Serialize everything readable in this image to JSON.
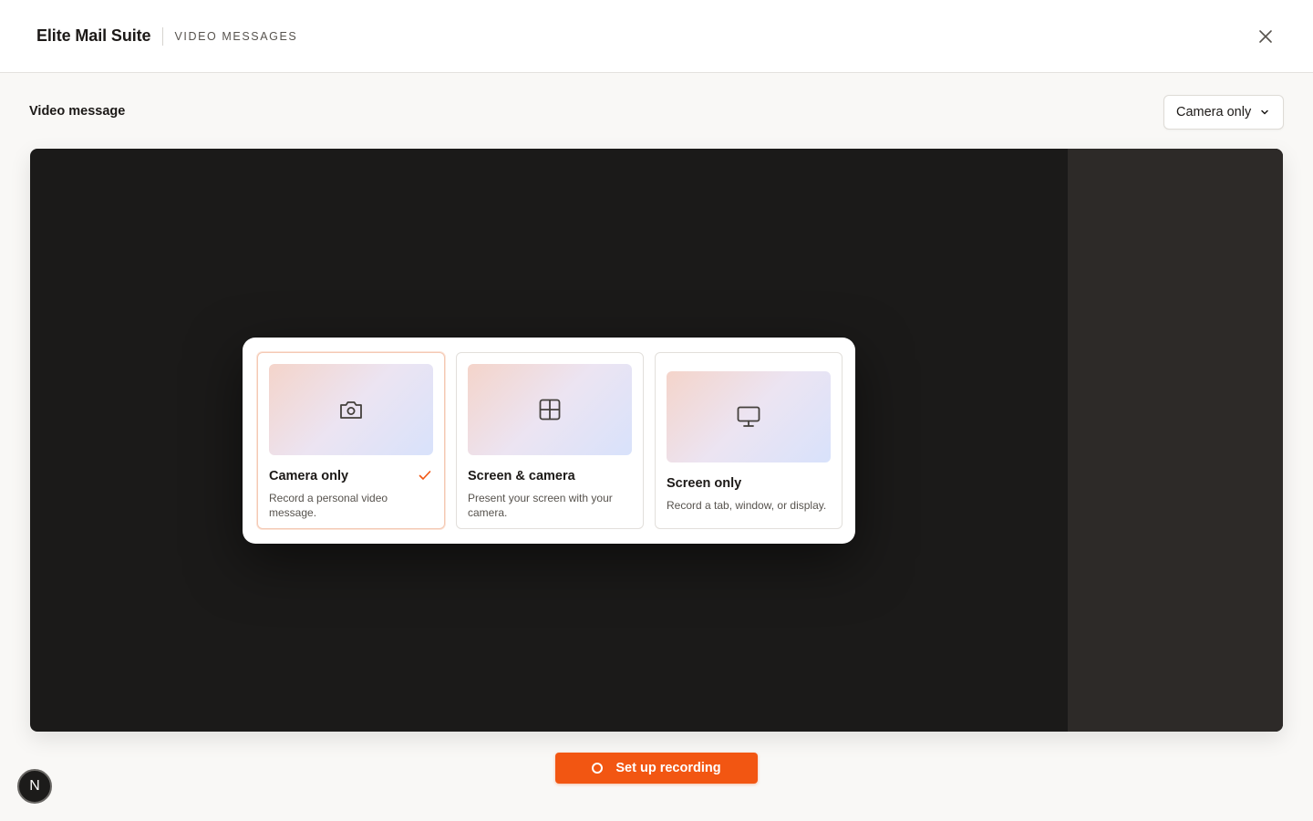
{
  "header": {
    "app_title": "Elite Mail Suite",
    "section_tag": "VIDEO MESSAGES",
    "close_icon": "close-icon"
  },
  "main": {
    "heading": "Video message",
    "mode_select": {
      "selected": "Camera only",
      "icon": "chevron-down-icon"
    }
  },
  "picker": {
    "options": [
      {
        "title": "Camera only",
        "description": "Record a personal video message.",
        "icon": "camera-icon",
        "selected": true
      },
      {
        "title": "Screen & camera",
        "description": "Present your screen with your camera.",
        "icon": "layout-grid-icon",
        "selected": false
      },
      {
        "title": "Screen only",
        "description": "Record a tab, window, or display.",
        "icon": "monitor-icon",
        "selected": false
      }
    ]
  },
  "footer": {
    "record_label": "Set up recording",
    "avatar_initial": "N"
  },
  "colors": {
    "accent": "#f25612",
    "stage": "#1b1a19",
    "stage_side": "#2d2a28"
  }
}
